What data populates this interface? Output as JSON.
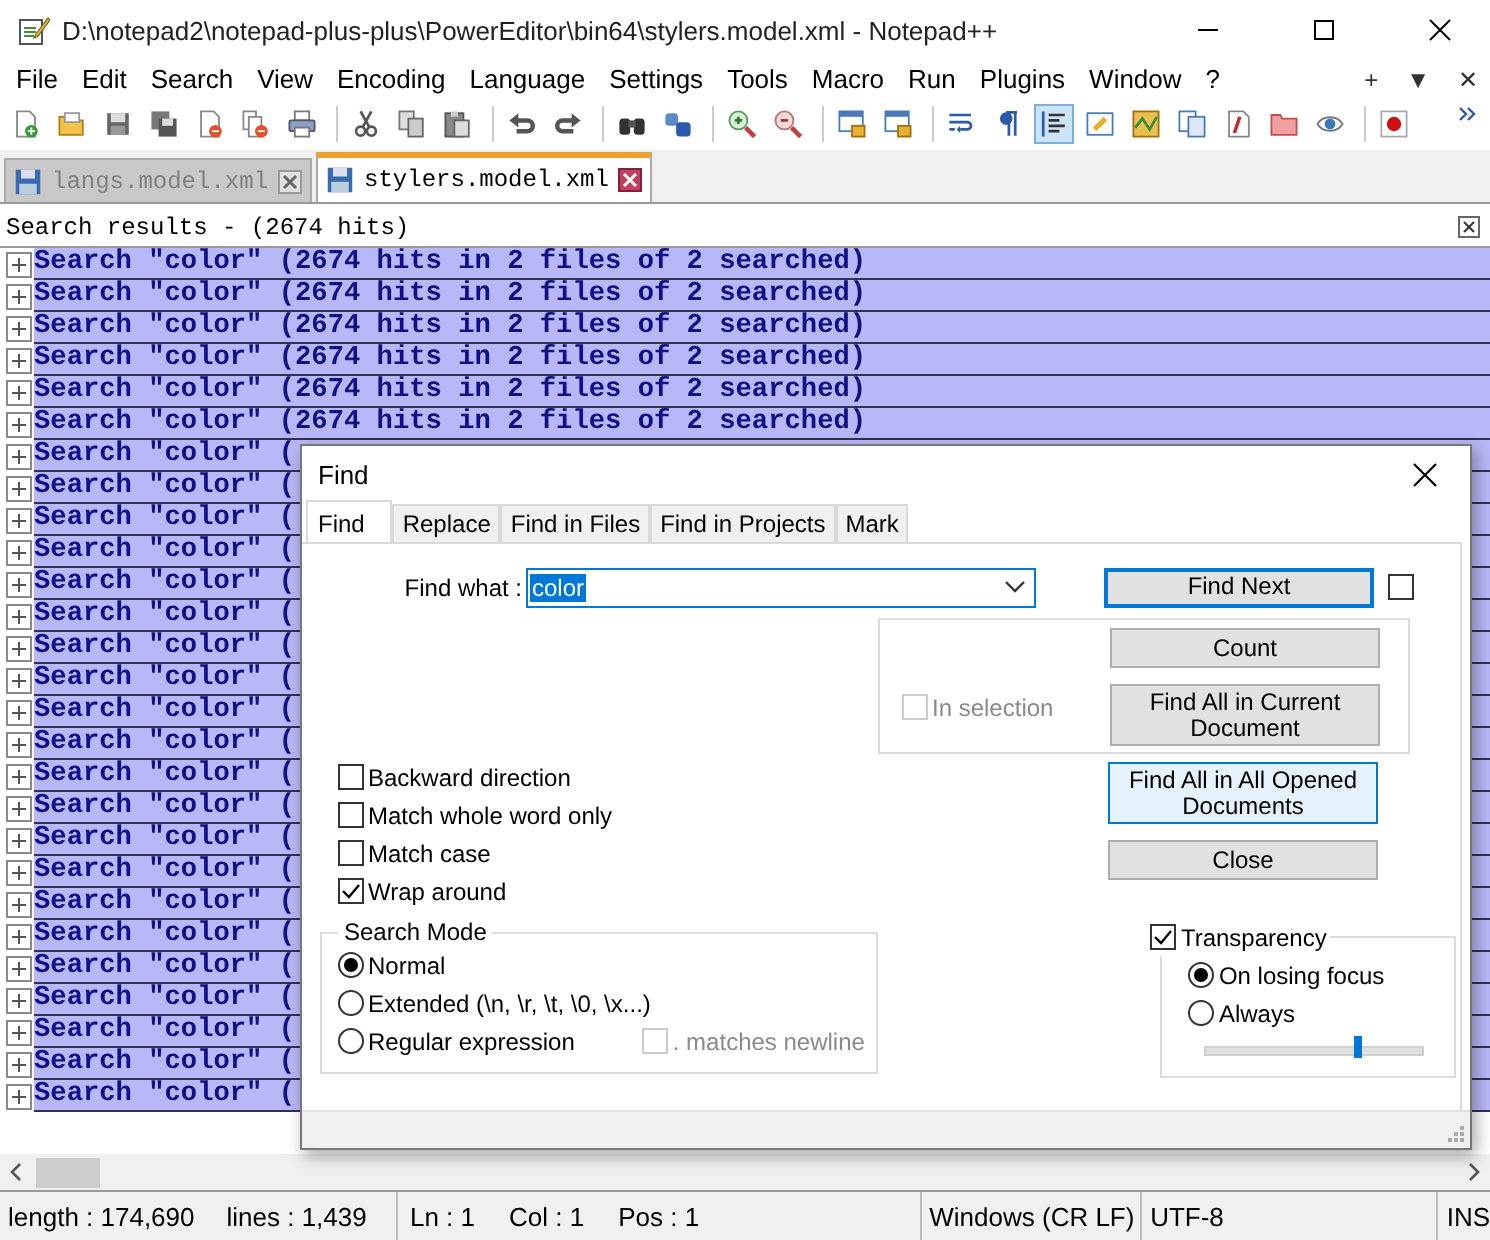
{
  "window": {
    "title": "D:\\notepad2\\notepad-plus-plus\\PowerEditor\\bin64\\stylers.model.xml - Notepad++"
  },
  "menu": [
    "File",
    "Edit",
    "Search",
    "View",
    "Encoding",
    "Language",
    "Settings",
    "Tools",
    "Macro",
    "Run",
    "Plugins",
    "Window",
    "?"
  ],
  "menu_extras": [
    "+",
    "▼",
    "✕"
  ],
  "toolbar": [
    {
      "kind": "new",
      "pressed": false
    },
    {
      "kind": "open",
      "pressed": false
    },
    {
      "kind": "save",
      "pressed": false
    },
    {
      "kind": "saveall",
      "pressed": false
    },
    {
      "kind": "close",
      "pressed": false
    },
    {
      "kind": "closeall",
      "pressed": false
    },
    {
      "kind": "print",
      "pressed": false
    },
    {
      "kind": "separator"
    },
    {
      "kind": "cut",
      "pressed": false
    },
    {
      "kind": "copy",
      "pressed": false
    },
    {
      "kind": "paste",
      "pressed": false
    },
    {
      "kind": "separator"
    },
    {
      "kind": "undo",
      "pressed": false
    },
    {
      "kind": "redo",
      "pressed": false
    },
    {
      "kind": "separator"
    },
    {
      "kind": "find",
      "pressed": false
    },
    {
      "kind": "replace",
      "pressed": false
    },
    {
      "kind": "separator"
    },
    {
      "kind": "zoomin",
      "pressed": false
    },
    {
      "kind": "zoomout",
      "pressed": false
    },
    {
      "kind": "separator"
    },
    {
      "kind": "sync",
      "pressed": false
    },
    {
      "kind": "sync",
      "pressed": false
    },
    {
      "kind": "separator"
    },
    {
      "kind": "wrap",
      "pressed": false
    },
    {
      "kind": "pilcrow",
      "pressed": false
    },
    {
      "kind": "indent",
      "pressed": true
    },
    {
      "kind": "udl",
      "pressed": false
    },
    {
      "kind": "map",
      "pressed": false
    },
    {
      "kind": "doclist",
      "pressed": false
    },
    {
      "kind": "funclist",
      "pressed": false
    },
    {
      "kind": "folder",
      "pressed": false
    },
    {
      "kind": "eye",
      "pressed": false
    },
    {
      "kind": "separator"
    },
    {
      "kind": "record",
      "pressed": false
    }
  ],
  "tabs": [
    {
      "label": "langs.model.xml",
      "selected": false
    },
    {
      "label": "stylers.model.xml",
      "selected": true
    }
  ],
  "results_panel": {
    "title": "Search results - (2674 hits)",
    "rows": [
      "Search \"color\" (2674 hits in 2 files of 2 searched)",
      "Search \"color\" (2674 hits in 2 files of 2 searched)",
      "Search \"color\" (2674 hits in 2 files of 2 searched)",
      "Search \"color\" (2674 hits in 2 files of 2 searched)",
      "Search \"color\" (2674 hits in 2 files of 2 searched)",
      "Search \"color\" (2674 hits in 2 files of 2 searched)",
      "Search \"color\" (",
      "Search \"color\" (",
      "Search \"color\" (",
      "Search \"color\" (",
      "Search \"color\" (",
      "Search \"color\" (",
      "Search \"color\" (",
      "Search \"color\" (",
      "Search \"color\" (",
      "Search \"color\" (",
      "Search \"color\" (",
      "Search \"color\" (",
      "Search \"color\" (",
      "Search \"color\" (",
      "Search \"color\" (",
      "Search \"color\" (",
      "Search \"color\" (",
      "Search \"color\" (",
      "Search \"color\" (",
      "Search \"color\" (",
      "Search \"color\" ("
    ]
  },
  "status_bar": [
    [
      "length : 174,690",
      "lines : 1,439"
    ],
    [
      "Ln : 1",
      "Col : 1",
      "Pos : 1"
    ],
    [
      "Windows (CR LF)"
    ],
    [
      "UTF-8"
    ],
    [
      "INS"
    ]
  ],
  "find_dialog": {
    "title": "Find",
    "tabs": [
      {
        "label": "Find",
        "selected": true
      },
      {
        "label": "Replace",
        "selected": false
      },
      {
        "label": "Find in Files",
        "selected": false
      },
      {
        "label": "Find in Projects",
        "selected": false
      },
      {
        "label": "Mark",
        "selected": false
      }
    ],
    "find_what": {
      "label": "Find what :",
      "value": "color"
    },
    "find_next": {
      "label": "Find Next",
      "focused": true,
      "hovered": false
    },
    "side_checkbox": {
      "checked": false
    },
    "in_selection": {
      "label": "In selection",
      "checked": false,
      "disabled": true
    },
    "count": {
      "label": "Count",
      "focused": false,
      "hovered": false
    },
    "find_all_current": {
      "label": "Find All in Current Document",
      "focused": false,
      "hovered": false
    },
    "options": [
      {
        "label": "Backward direction",
        "checked": false
      },
      {
        "label": "Match whole word only",
        "checked": false
      },
      {
        "label": "Match case",
        "checked": false
      },
      {
        "label": "Wrap around",
        "checked": true
      }
    ],
    "find_all_opened": {
      "label": "Find All in All Opened Documents",
      "focused": false,
      "hovered": true
    },
    "close": {
      "label": "Close",
      "focused": false,
      "hovered": false
    },
    "search_mode": {
      "title": "Search Mode",
      "modes": [
        {
          "label": "Normal",
          "selected": true
        },
        {
          "label": "Extended (\\n, \\r, \\t, \\0, \\x...)",
          "selected": false
        },
        {
          "label": "Regular expression",
          "selected": false
        }
      ],
      "dot_matches_newline": {
        "label": ". matches newline",
        "checked": false,
        "disabled": true
      }
    },
    "transparency": {
      "label": "Transparency",
      "checked": true,
      "modes": [
        {
          "label": "On losing focus",
          "selected": true
        },
        {
          "label": "Always",
          "selected": false
        }
      ],
      "level": 0.7
    }
  }
}
